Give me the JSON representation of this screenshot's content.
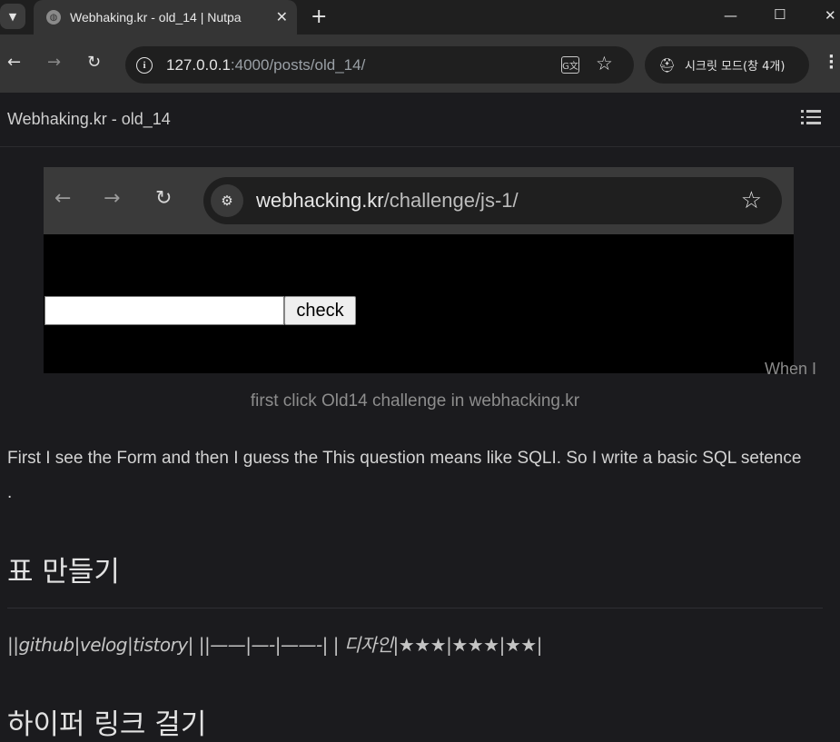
{
  "browser": {
    "tab_title": "Webhaking.kr - old_14 | Nutpa",
    "url_host": "127.0.0.1",
    "url_path": ":4000/posts/old_14/",
    "incognito_label": "시크릿 모드(창 4개)",
    "icons": {
      "tab_dropdown": "chevron-down-icon",
      "favicon": "globe-icon",
      "close": "close-icon",
      "new_tab": "plus-icon",
      "minimize": "minimize-icon",
      "maximize": "maximize-icon",
      "close_window": "close-window-icon",
      "back": "back-arrow-icon",
      "forward": "forward-arrow-icon",
      "reload": "reload-icon",
      "site_info": "info-icon",
      "translate": "translate-icon",
      "bookmark": "star-icon",
      "incognito": "incognito-icon",
      "menu": "more-vert-icon"
    }
  },
  "site": {
    "title": "Webhaking.kr - old_14",
    "toc_icon": "list-icon"
  },
  "post": {
    "embedded_screenshot": {
      "url_host": "webhacking.kr",
      "url_path": "/challenge/js-1/",
      "button_label": "check"
    },
    "caption_overflow": "When I",
    "caption": "first click Old14 challenge in webhacking.kr",
    "paragraph": "First I see the Form and then I guess the This question means like SQLI. So I write a basic SQL setence .",
    "heading_table": "표 만들기",
    "table_raw": "||github|velog|tistory| ||——|—-|——-| | 디자인|★★★|★★★|★★|",
    "heading_next": "하이퍼 링크 걸기"
  },
  "colors": {
    "page_bg": "#1b1b1e",
    "browser_toolbar": "#353535",
    "text_primary": "#d3d3d3",
    "text_caption": "#8d8d8d"
  }
}
